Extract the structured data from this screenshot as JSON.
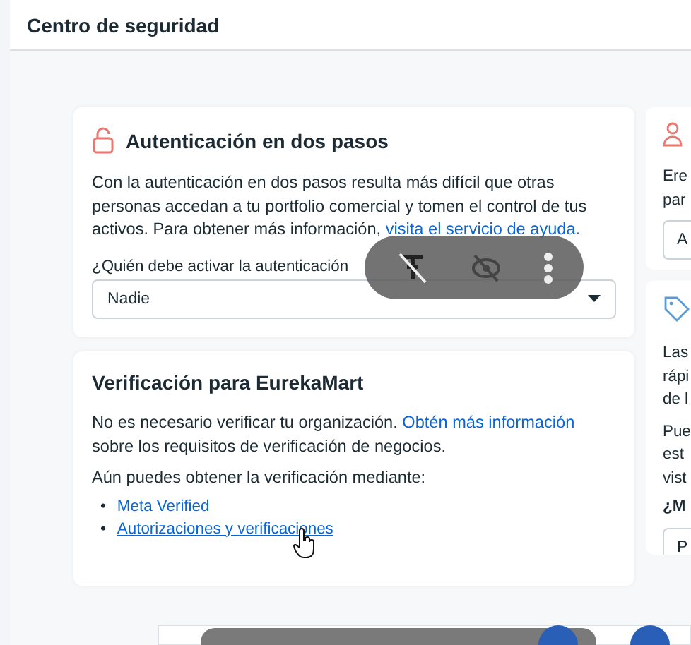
{
  "header": {
    "title": "Centro de seguridad"
  },
  "two_step_card": {
    "title": "Autenticación en dos pasos",
    "description": "Con la autenticación en dos pasos resulta más difícil que otras personas accedan a tu portfolio comercial y tomen el control de tus activos. Para obtener más información, ",
    "help_link": "visita el servicio de ayuda.",
    "question": "¿Quién debe activar la autenticación",
    "select_value": "Nadie"
  },
  "verification_card": {
    "title": "Verificación para EurekaMart",
    "text": "No es necesario verificar tu organización. ",
    "learn_link": "Obtén más información",
    "text_after": " sobre los requisitos de verificación de negocios.",
    "options_intro": "Aún puedes obtener la verificación mediante:",
    "options": [
      {
        "bullet": "•",
        "label": "Meta Verified"
      },
      {
        "bullet": "•",
        "label": "Autorizaciones y verificaciones"
      }
    ]
  },
  "right_card_1": {
    "lines": [
      "Ere",
      "par"
    ],
    "field_value": "A"
  },
  "right_card_2": {
    "lines_1": [
      "Las",
      "rápi",
      "de l"
    ],
    "lines_2": [
      "Pue",
      "est",
      "vist"
    ],
    "question": "¿M",
    "field_value": "P"
  }
}
